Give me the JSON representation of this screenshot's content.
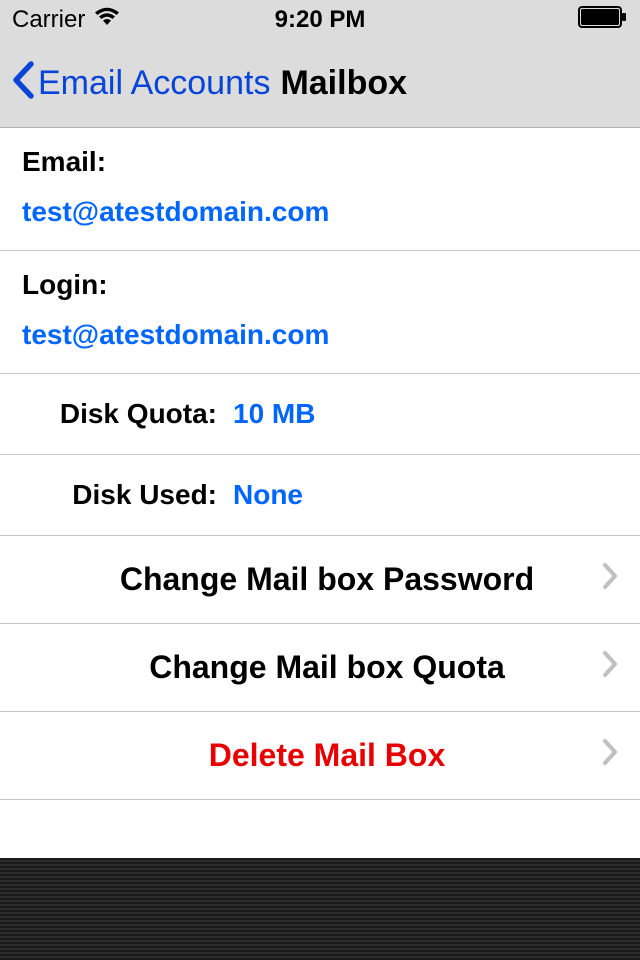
{
  "status_bar": {
    "carrier": "Carrier",
    "time": "9:20 PM"
  },
  "nav": {
    "back_label": "Email Accounts",
    "title": "Mailbox"
  },
  "info": {
    "email_label": "Email:",
    "email_value": "test@atestdomain.com",
    "login_label": "Login:",
    "login_value": "test@atestdomain.com"
  },
  "stats": {
    "disk_quota_label": "Disk Quota:",
    "disk_quota_value": "10 MB",
    "disk_used_label": "Disk Used:",
    "disk_used_value": "None"
  },
  "actions": {
    "change_password": "Change Mail box Password",
    "change_quota": "Change Mail box Quota",
    "delete": "Delete Mail Box"
  }
}
